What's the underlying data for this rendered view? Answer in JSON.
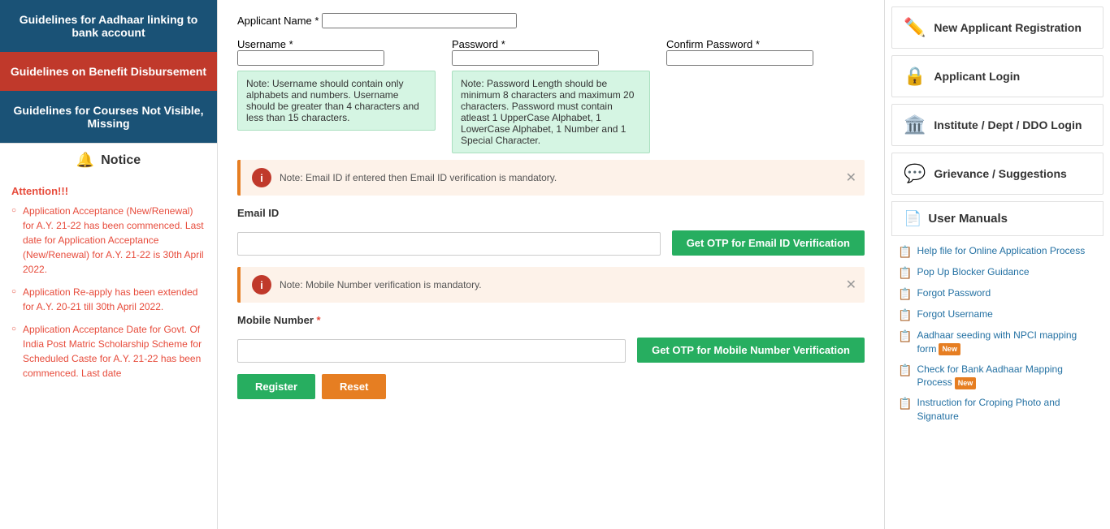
{
  "sidebar": {
    "btn1_label": "Guidelines for Aadhaar linking to bank account",
    "btn2_label": "Guidelines on Benefit Disbursement",
    "btn3_label": "Guidelines for Courses Not Visible, Missing",
    "notice_label": "Notice",
    "attention_label": "Attention!!!",
    "notice_items": [
      "Application Acceptance (New/Renewal) for A.Y. 21-22 has been commenced. Last date for Application Acceptance (New/Renewal) for A.Y. 21-22 is 30th April 2022.",
      "Application Re-apply has been extended for A.Y. 20-21 till 30th April 2022.",
      "Application Acceptance Date for Govt. Of India Post Matric Scholarship Scheme for Scheduled Caste for A.Y. 21-22 has been commenced. Last date"
    ]
  },
  "form": {
    "applicant_name_label": "Applicant Name",
    "username_label": "Username",
    "password_label": "Password",
    "confirm_password_label": "Confirm Password",
    "username_note": "Note: Username should contain only alphabets and numbers. Username should be greater than 4 characters and less than 15 characters.",
    "password_note": "Note: Password Length should be minimum 8 characters and maximum 20 characters. Password must contain atleast 1 UpperCase Alphabet, 1 LowerCase Alphabet, 1 Number and 1 Special Character.",
    "email_alert": "Note: Email ID if entered then Email ID verification is mandatory.",
    "mobile_alert": "Note: Mobile Number verification is mandatory.",
    "email_label": "Email ID",
    "mobile_label": "Mobile Number",
    "otp_email_btn": "Get OTP for Email ID Verification",
    "otp_mobile_btn": "Get OTP for Mobile Number Verification",
    "register_btn": "Register",
    "reset_btn": "Reset"
  },
  "right_sidebar": {
    "new_applicant_label": "New Applicant Registration",
    "applicant_login_label": "Applicant Login",
    "institute_login_label": "Institute / Dept / DDO Login",
    "grievance_label": "Grievance / Suggestions",
    "user_manuals_label": "User Manuals",
    "links": [
      {
        "label": "Help file for Online Application Process",
        "new": false
      },
      {
        "label": "Pop Up Blocker Guidance",
        "new": false
      },
      {
        "label": "Forgot Password",
        "new": false
      },
      {
        "label": "Forgot Username",
        "new": false
      },
      {
        "label": "Aadhaar seeding with NPCI mapping form",
        "new": true
      },
      {
        "label": "Check for Bank Aadhaar Mapping Process",
        "new": true
      },
      {
        "label": "Instruction for Croping Photo and Signature",
        "new": false
      }
    ]
  }
}
